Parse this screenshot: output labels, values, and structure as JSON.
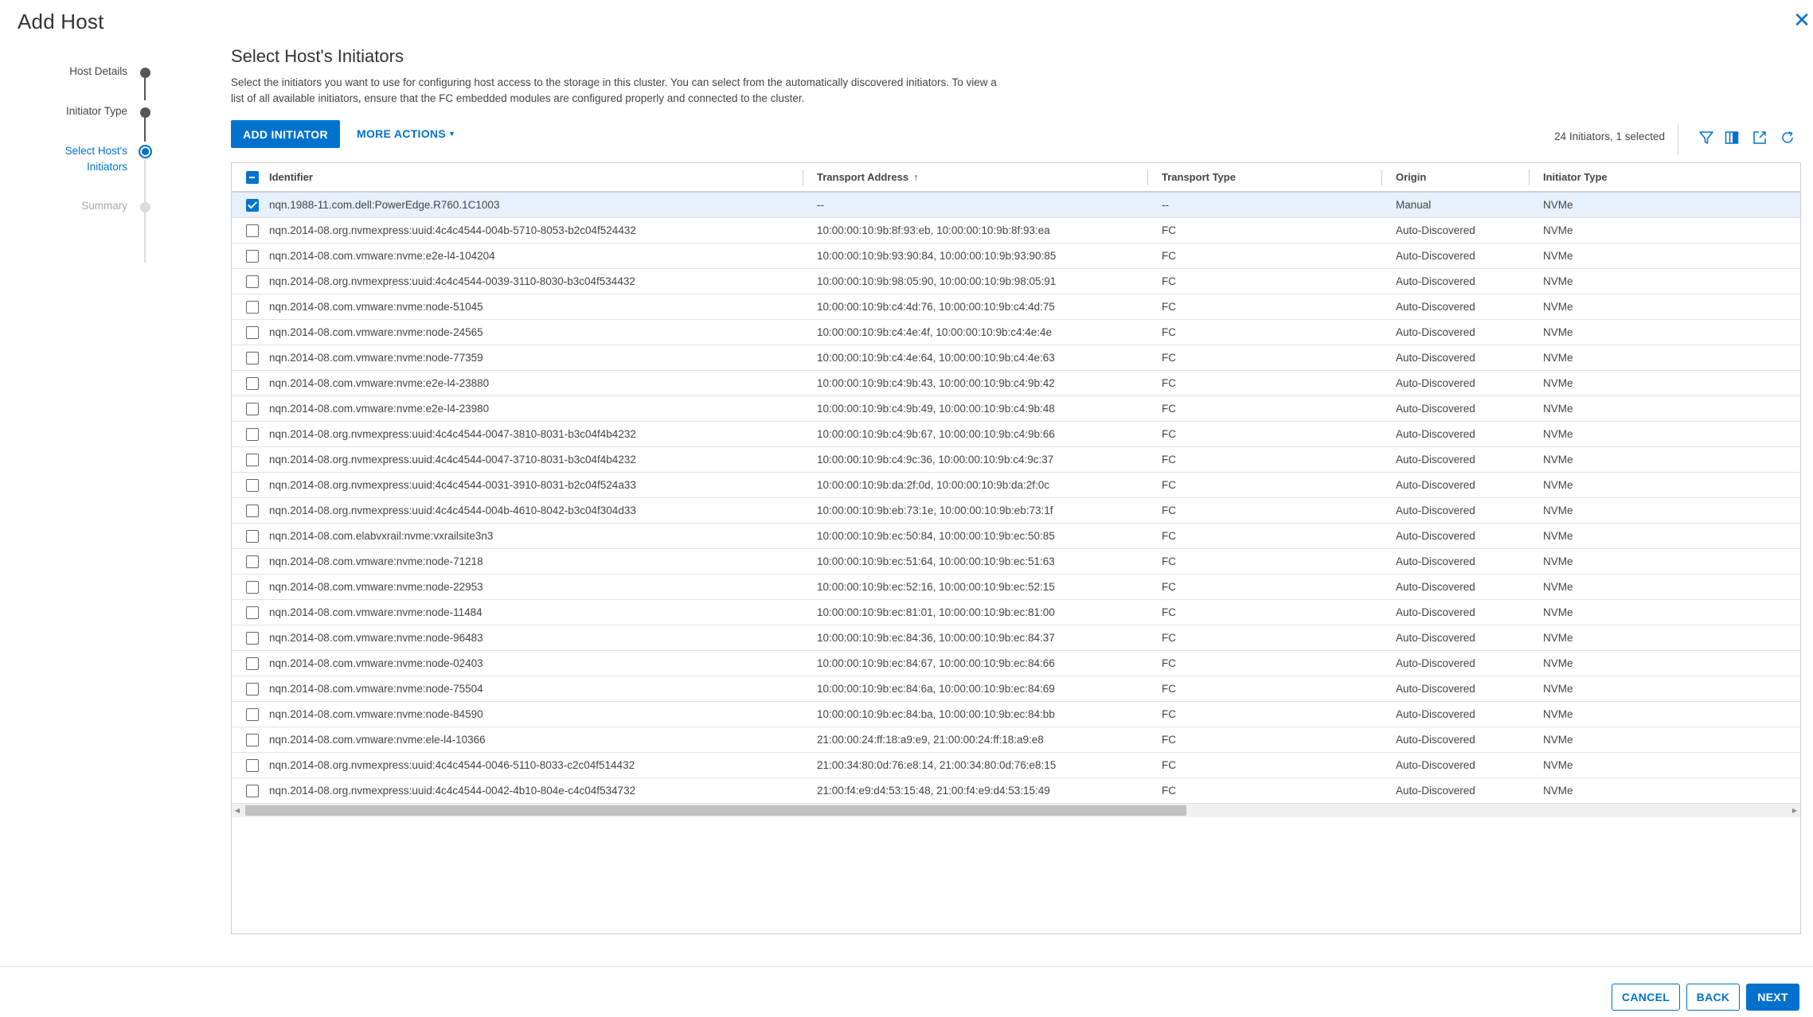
{
  "dialog": {
    "title": "Add Host",
    "close_icon": "close-icon"
  },
  "stepper": {
    "steps": [
      {
        "label": "Host Details",
        "state": "done"
      },
      {
        "label": "Initiator Type",
        "state": "done"
      },
      {
        "label_line1": "Select Host's",
        "label_line2": "Initiators",
        "state": "active"
      },
      {
        "label": "Summary",
        "state": "todo"
      }
    ]
  },
  "section": {
    "title": "Select Host's Initiators",
    "description_line1": "Select the initiators you want to use for configuring host access to the storage in this cluster. You can select from the automatically discovered initiators. To view a",
    "description_line2": "list of all available initiators, ensure that the FC embedded modules are configured properly and connected to the cluster."
  },
  "toolbar": {
    "add_initiator_label": "ADD INITIATOR",
    "more_actions_label": "MORE ACTIONS",
    "count_text": "24 Initiators, 1 selected",
    "icons": [
      "filter-icon",
      "columns-icon",
      "export-icon",
      "refresh-icon"
    ]
  },
  "table": {
    "columns": [
      "Identifier",
      "Transport Address",
      "Transport Type",
      "Origin",
      "Initiator Type"
    ],
    "sort": {
      "column": "Transport Address",
      "direction": "ascending"
    },
    "header_checkbox_state": "indeterminate",
    "rows": [
      {
        "selected": true,
        "identifier": "nqn.1988-11.com.dell:PowerEdge.R760.1C1003",
        "address": "--",
        "transport_type": "--",
        "origin": "Manual",
        "initiator_type": "NVMe"
      },
      {
        "selected": false,
        "identifier": "nqn.2014-08.org.nvmexpress:uuid:4c4c4544-004b-5710-8053-b2c04f524432",
        "address": "10:00:00:10:9b:8f:93:eb, 10:00:00:10:9b:8f:93:ea",
        "transport_type": "FC",
        "origin": "Auto-Discovered",
        "initiator_type": "NVMe"
      },
      {
        "selected": false,
        "identifier": "nqn.2014-08.com.vmware:nvme:e2e-l4-104204",
        "address": "10:00:00:10:9b:93:90:84, 10:00:00:10:9b:93:90:85",
        "transport_type": "FC",
        "origin": "Auto-Discovered",
        "initiator_type": "NVMe"
      },
      {
        "selected": false,
        "identifier": "nqn.2014-08.org.nvmexpress:uuid:4c4c4544-0039-3110-8030-b3c04f534432",
        "address": "10:00:00:10:9b:98:05:90, 10:00:00:10:9b:98:05:91",
        "transport_type": "FC",
        "origin": "Auto-Discovered",
        "initiator_type": "NVMe"
      },
      {
        "selected": false,
        "identifier": "nqn.2014-08.com.vmware:nvme:node-51045",
        "address": "10:00:00:10:9b:c4:4d:76, 10:00:00:10:9b:c4:4d:75",
        "transport_type": "FC",
        "origin": "Auto-Discovered",
        "initiator_type": "NVMe"
      },
      {
        "selected": false,
        "identifier": "nqn.2014-08.com.vmware:nvme:node-24565",
        "address": "10:00:00:10:9b:c4:4e:4f, 10:00:00:10:9b:c4:4e:4e",
        "transport_type": "FC",
        "origin": "Auto-Discovered",
        "initiator_type": "NVMe"
      },
      {
        "selected": false,
        "identifier": "nqn.2014-08.com.vmware:nvme:node-77359",
        "address": "10:00:00:10:9b:c4:4e:64, 10:00:00:10:9b:c4:4e:63",
        "transport_type": "FC",
        "origin": "Auto-Discovered",
        "initiator_type": "NVMe"
      },
      {
        "selected": false,
        "identifier": "nqn.2014-08.com.vmware:nvme:e2e-l4-23880",
        "address": "10:00:00:10:9b:c4:9b:43, 10:00:00:10:9b:c4:9b:42",
        "transport_type": "FC",
        "origin": "Auto-Discovered",
        "initiator_type": "NVMe"
      },
      {
        "selected": false,
        "identifier": "nqn.2014-08.com.vmware:nvme:e2e-l4-23980",
        "address": "10:00:00:10:9b:c4:9b:49, 10:00:00:10:9b:c4:9b:48",
        "transport_type": "FC",
        "origin": "Auto-Discovered",
        "initiator_type": "NVMe"
      },
      {
        "selected": false,
        "identifier": "nqn.2014-08.org.nvmexpress:uuid:4c4c4544-0047-3810-8031-b3c04f4b4232",
        "address": "10:00:00:10:9b:c4:9b:67, 10:00:00:10:9b:c4:9b:66",
        "transport_type": "FC",
        "origin": "Auto-Discovered",
        "initiator_type": "NVMe"
      },
      {
        "selected": false,
        "identifier": "nqn.2014-08.org.nvmexpress:uuid:4c4c4544-0047-3710-8031-b3c04f4b4232",
        "address": "10:00:00:10:9b:c4:9c:36, 10:00:00:10:9b:c4:9c:37",
        "transport_type": "FC",
        "origin": "Auto-Discovered",
        "initiator_type": "NVMe"
      },
      {
        "selected": false,
        "identifier": "nqn.2014-08.org.nvmexpress:uuid:4c4c4544-0031-3910-8031-b2c04f524a33",
        "address": "10:00:00:10:9b:da:2f:0d, 10:00:00:10:9b:da:2f:0c",
        "transport_type": "FC",
        "origin": "Auto-Discovered",
        "initiator_type": "NVMe"
      },
      {
        "selected": false,
        "identifier": "nqn.2014-08.org.nvmexpress:uuid:4c4c4544-004b-4610-8042-b3c04f304d33",
        "address": "10:00:00:10:9b:eb:73:1e, 10:00:00:10:9b:eb:73:1f",
        "transport_type": "FC",
        "origin": "Auto-Discovered",
        "initiator_type": "NVMe"
      },
      {
        "selected": false,
        "identifier": "nqn.2014-08.com.elabvxrail:nvme:vxrailsite3n3",
        "address": "10:00:00:10:9b:ec:50:84, 10:00:00:10:9b:ec:50:85",
        "transport_type": "FC",
        "origin": "Auto-Discovered",
        "initiator_type": "NVMe"
      },
      {
        "selected": false,
        "identifier": "nqn.2014-08.com.vmware:nvme:node-71218",
        "address": "10:00:00:10:9b:ec:51:64, 10:00:00:10:9b:ec:51:63",
        "transport_type": "FC",
        "origin": "Auto-Discovered",
        "initiator_type": "NVMe"
      },
      {
        "selected": false,
        "identifier": "nqn.2014-08.com.vmware:nvme:node-22953",
        "address": "10:00:00:10:9b:ec:52:16, 10:00:00:10:9b:ec:52:15",
        "transport_type": "FC",
        "origin": "Auto-Discovered",
        "initiator_type": "NVMe"
      },
      {
        "selected": false,
        "identifier": "nqn.2014-08.com.vmware:nvme:node-11484",
        "address": "10:00:00:10:9b:ec:81:01, 10:00:00:10:9b:ec:81:00",
        "transport_type": "FC",
        "origin": "Auto-Discovered",
        "initiator_type": "NVMe"
      },
      {
        "selected": false,
        "identifier": "nqn.2014-08.com.vmware:nvme:node-96483",
        "address": "10:00:00:10:9b:ec:84:36, 10:00:00:10:9b:ec:84:37",
        "transport_type": "FC",
        "origin": "Auto-Discovered",
        "initiator_type": "NVMe"
      },
      {
        "selected": false,
        "identifier": "nqn.2014-08.com.vmware:nvme:node-02403",
        "address": "10:00:00:10:9b:ec:84:67, 10:00:00:10:9b:ec:84:66",
        "transport_type": "FC",
        "origin": "Auto-Discovered",
        "initiator_type": "NVMe"
      },
      {
        "selected": false,
        "identifier": "nqn.2014-08.com.vmware:nvme:node-75504",
        "address": "10:00:00:10:9b:ec:84:6a, 10:00:00:10:9b:ec:84:69",
        "transport_type": "FC",
        "origin": "Auto-Discovered",
        "initiator_type": "NVMe"
      },
      {
        "selected": false,
        "identifier": "nqn.2014-08.com.vmware:nvme:node-84590",
        "address": "10:00:00:10:9b:ec:84:ba, 10:00:00:10:9b:ec:84:bb",
        "transport_type": "FC",
        "origin": "Auto-Discovered",
        "initiator_type": "NVMe"
      },
      {
        "selected": false,
        "identifier": "nqn.2014-08.com.vmware:nvme:ele-l4-10366",
        "address": "21:00:00:24:ff:18:a9:e9, 21:00:00:24:ff:18:a9:e8",
        "transport_type": "FC",
        "origin": "Auto-Discovered",
        "initiator_type": "NVMe"
      },
      {
        "selected": false,
        "identifier": "nqn.2014-08.org.nvmexpress:uuid:4c4c4544-0046-5110-8033-c2c04f514432",
        "address": "21:00:34:80:0d:76:e8:14, 21:00:34:80:0d:76:e8:15",
        "transport_type": "FC",
        "origin": "Auto-Discovered",
        "initiator_type": "NVMe"
      },
      {
        "selected": false,
        "identifier": "nqn.2014-08.org.nvmexpress:uuid:4c4c4544-0042-4b10-804e-c4c04f534732",
        "address": "21:00:f4:e9:d4:53:15:48, 21:00:f4:e9:d4:53:15:49",
        "transport_type": "FC",
        "origin": "Auto-Discovered",
        "initiator_type": "NVMe"
      }
    ]
  },
  "footer": {
    "cancel_label": "CANCEL",
    "back_label": "BACK",
    "next_label": "NEXT"
  },
  "colors": {
    "accent": "#0072ce",
    "selected_row": "#e6f1fb",
    "step_done": "#565656",
    "step_todo": "#dcdcdc"
  }
}
